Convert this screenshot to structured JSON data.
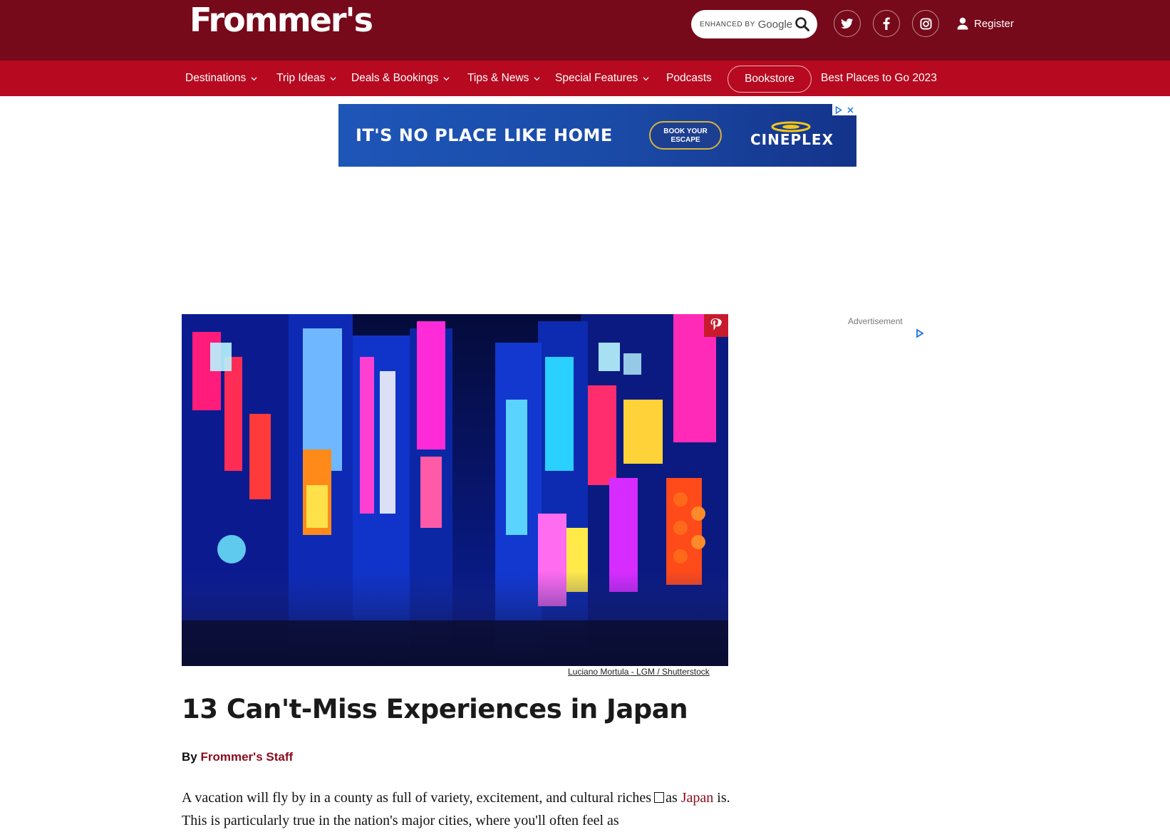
{
  "header": {
    "logo_text": "Frommer's",
    "search": {
      "enhanced_by": "ENHANCED BY",
      "provider": "Google",
      "icon": "search-icon"
    },
    "social": [
      {
        "name": "twitter",
        "icon": "twitter-icon"
      },
      {
        "name": "facebook",
        "icon": "facebook-icon"
      },
      {
        "name": "instagram",
        "icon": "instagram-icon"
      }
    ],
    "register_label": "Register",
    "colors": {
      "topbar": "#76091a",
      "navbar": "#b7091f"
    }
  },
  "nav": {
    "items": [
      {
        "label": "Destinations",
        "has_dropdown": true
      },
      {
        "label": "Trip Ideas",
        "has_dropdown": true
      },
      {
        "label": "Deals & Bookings",
        "has_dropdown": true
      },
      {
        "label": "Tips & News",
        "has_dropdown": true
      },
      {
        "label": "Special Features",
        "has_dropdown": true
      },
      {
        "label": "Podcasts",
        "has_dropdown": false
      },
      {
        "label": "Bookstore",
        "has_dropdown": false
      },
      {
        "label": "Best Places to Go 2023",
        "has_dropdown": false
      }
    ]
  },
  "ad_banner": {
    "headline": "IT'S NO PLACE LIKE HOME",
    "cta": "BOOK YOUR ESCAPE",
    "brand": "CINEPLEX"
  },
  "article": {
    "image_caption": "Luciano Mortula - LGM / Shutterstock",
    "title": "13 Can't-Miss Experiences in Japan",
    "byline_prefix": "By",
    "author": "Frommer's Staff",
    "intro_part1": "A vacation will fly by in a county as full of variety, excitement, and cultural riches",
    "intro_part2": "as",
    "intro_link": "Japan",
    "intro_part3": "is. This is particularly true in the nation's major cities, where you'll often feel as"
  },
  "sidebar": {
    "ad_label": "Advertisement"
  }
}
